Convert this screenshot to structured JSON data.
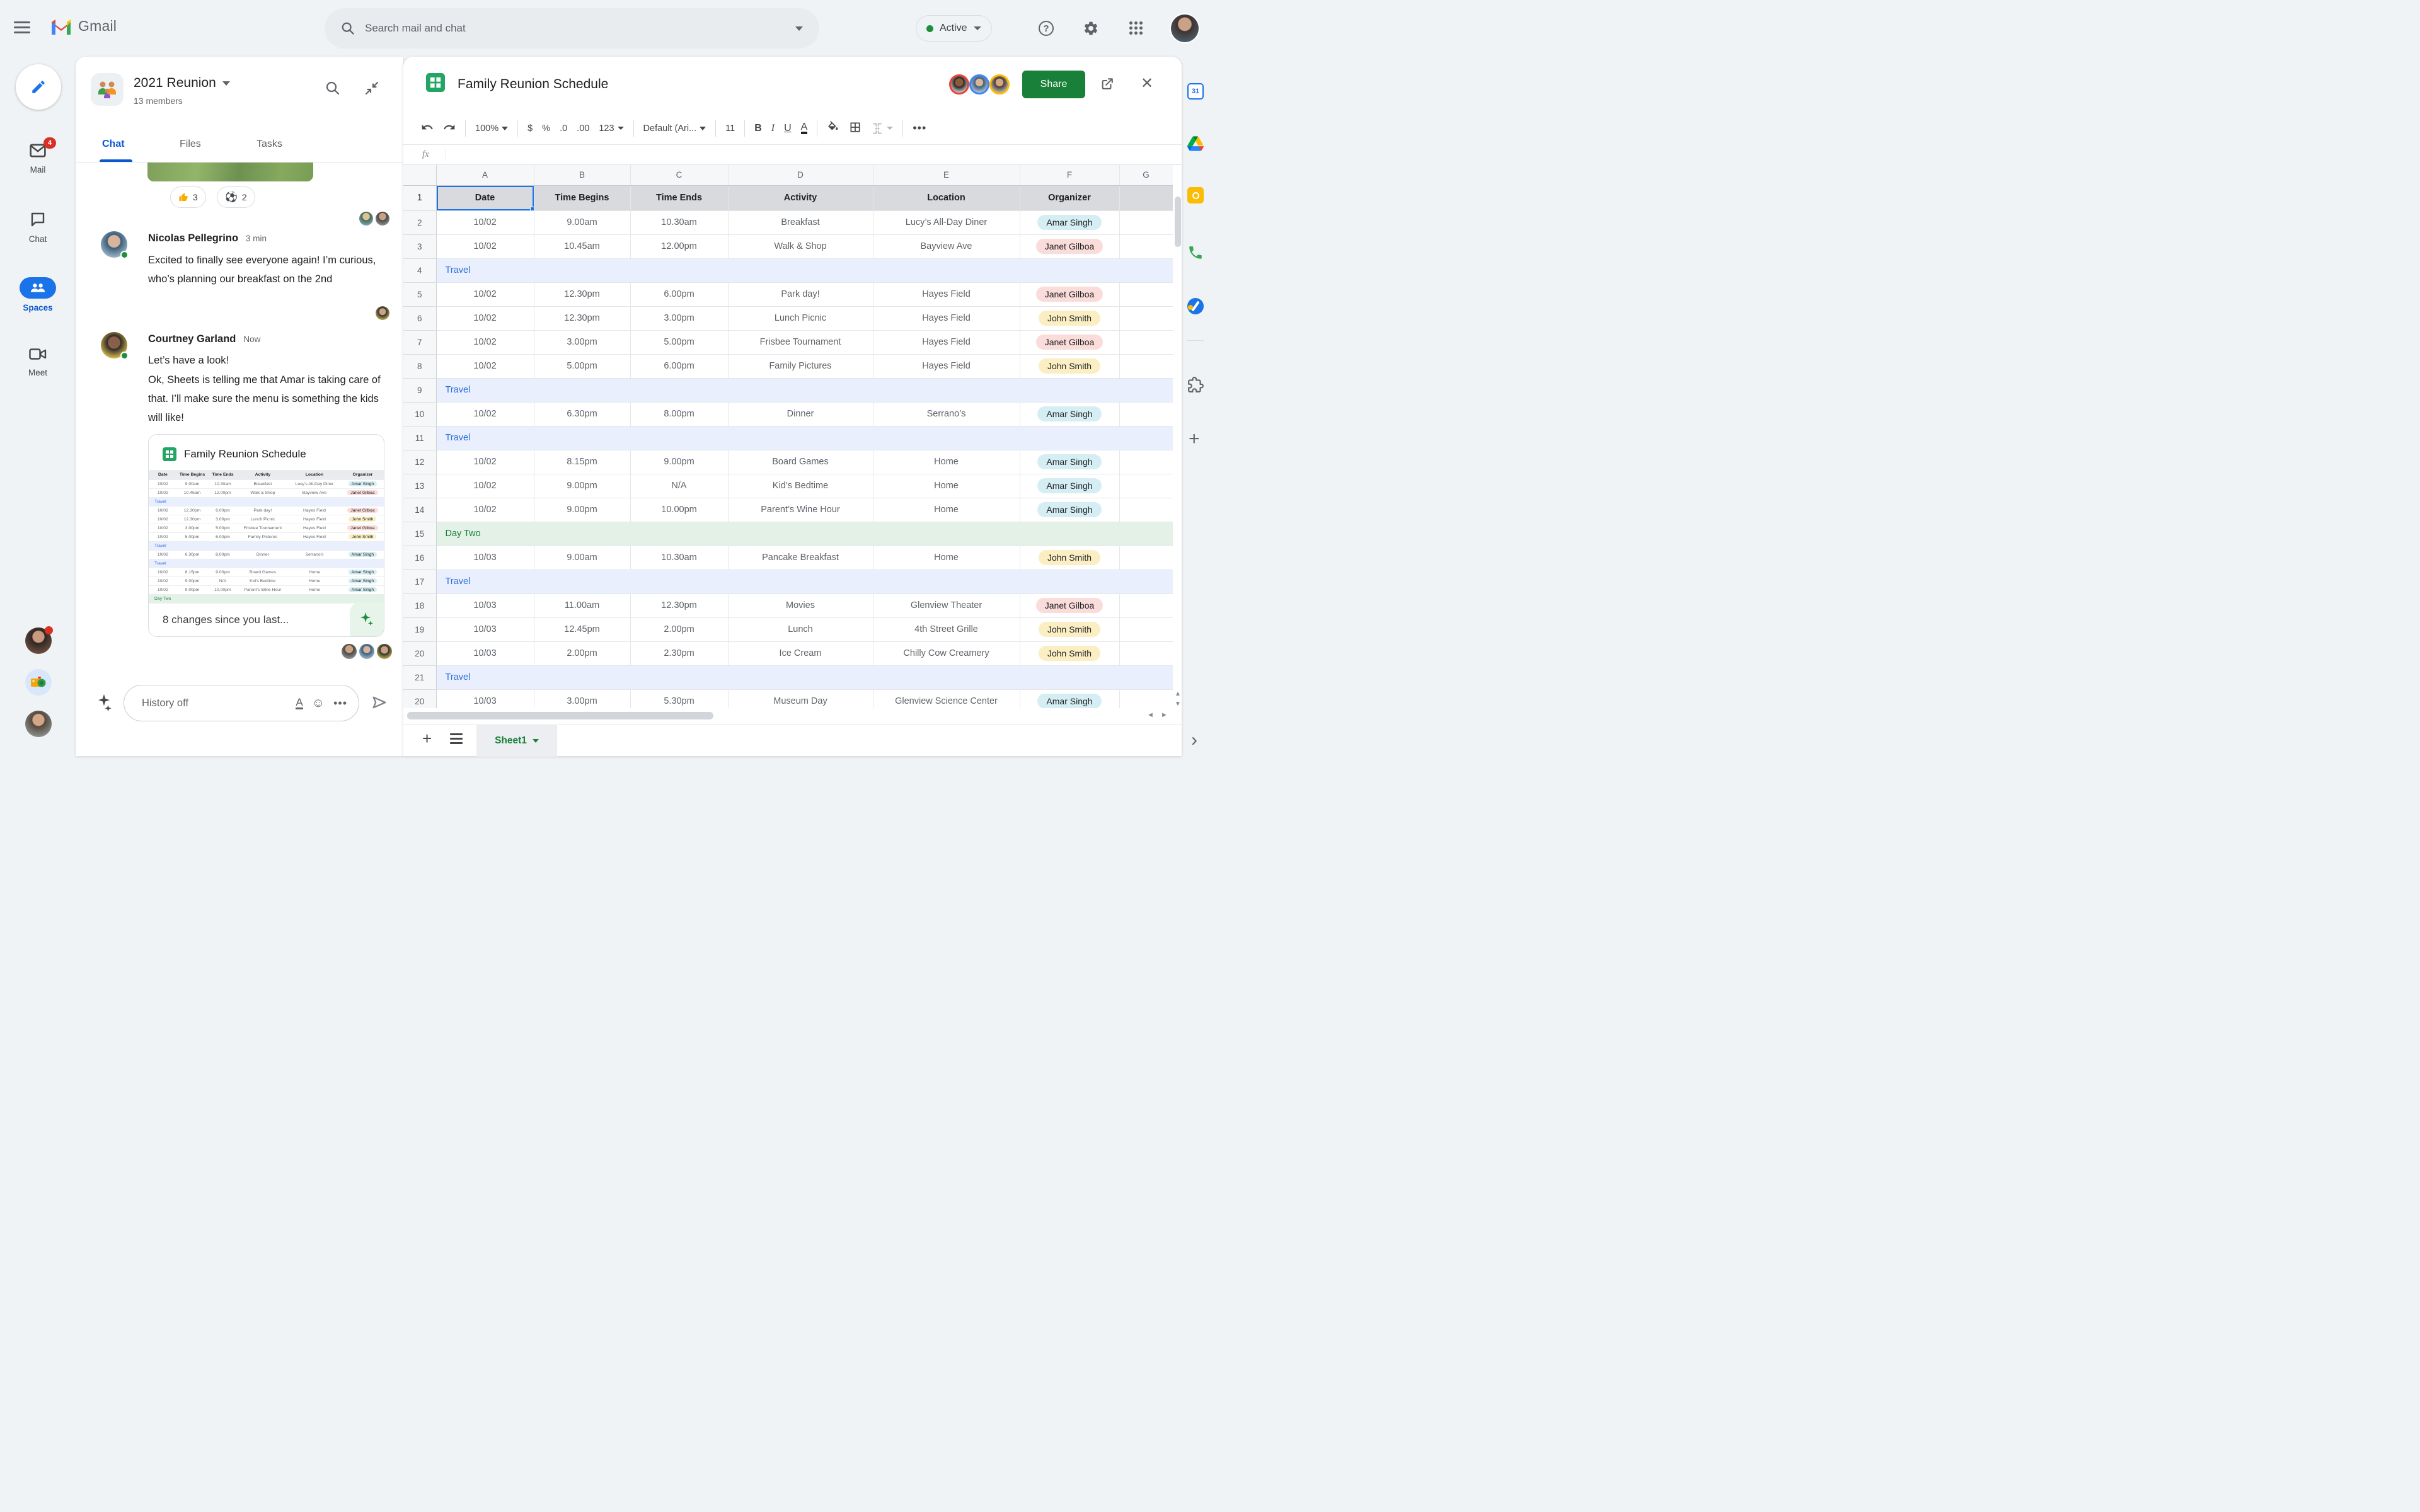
{
  "topbar": {
    "logo_text": "Gmail",
    "search": {
      "placeholder": "Search mail and chat"
    },
    "status": {
      "label": "Active"
    }
  },
  "rail": {
    "items": [
      {
        "label": "Mail",
        "badge": "4"
      },
      {
        "label": "Chat"
      },
      {
        "label": "Spaces"
      },
      {
        "label": "Meet"
      }
    ]
  },
  "chat": {
    "title": "2021 Reunion",
    "members": "13 members",
    "tabs": [
      "Chat",
      "Files",
      "Tasks"
    ],
    "reactions": [
      {
        "icon": "thumbs-up",
        "count": "3"
      },
      {
        "icon": "soccer-ball",
        "count": "2"
      }
    ],
    "messages": [
      {
        "author": "Nicolas Pellegrino",
        "time": "3 min",
        "text": "Excited to finally see everyone again! I’m curious, who’s planning our breakfast on the 2nd"
      },
      {
        "author": "Courtney Garland",
        "time": "Now",
        "text": "Let’s have a look!",
        "text2": "Ok, Sheets is telling me that Amar is taking care of that. I’ll make sure the menu is something the kids will like!"
      }
    ],
    "card": {
      "title": "Family Reunion Schedule",
      "footer": "8 changes since you last..."
    },
    "input": {
      "placeholder": "History off"
    }
  },
  "sheet": {
    "title": "Family Reunion Schedule",
    "share_label": "Share",
    "toolbar": {
      "zoom": "100%",
      "currency": "$",
      "percent": "%",
      "dec0": ".0",
      "dec00": ".00",
      "num_fmt": "123",
      "font": "Default (Ari...",
      "font_size": "11",
      "bold": "B",
      "italic": "I",
      "underline": "U",
      "text_color": "A"
    },
    "formula_bar": {
      "fx": "fx"
    },
    "columns": [
      "A",
      "B",
      "C",
      "D",
      "E",
      "F",
      "G"
    ],
    "header_row": [
      "Date",
      "Time Begins",
      "Time Ends",
      "Activity",
      "Location",
      "Organizer"
    ],
    "chip_colors": {
      "Amar Singh": "#d5eef3",
      "Janet Gilboa": "#fadcda",
      "John Smith": "#faeec2"
    },
    "band_styles": {
      "Travel": {
        "bg": "#e9effc",
        "color": "#2f6fe0"
      },
      "Day Two": {
        "bg": "#e4f1e7",
        "color": "#188038"
      }
    },
    "rows": [
      {
        "n": "2",
        "cells": [
          "10/02",
          "9.00am",
          "10.30am",
          "Breakfast",
          "Lucy’s All-Day Diner"
        ],
        "organizer": "Amar Singh"
      },
      {
        "n": "3",
        "cells": [
          "10/02",
          "10.45am",
          "12.00pm",
          "Walk & Shop",
          "Bayview Ave"
        ],
        "organizer": "Janet Gilboa"
      },
      {
        "n": "4",
        "band": "Travel"
      },
      {
        "n": "5",
        "cells": [
          "10/02",
          "12.30pm",
          "6.00pm",
          "Park day!",
          "Hayes Field"
        ],
        "organizer": "Janet Gilboa"
      },
      {
        "n": "6",
        "cells": [
          "10/02",
          "12.30pm",
          "3.00pm",
          "Lunch Picnic",
          "Hayes Field"
        ],
        "organizer": "John Smith"
      },
      {
        "n": "7",
        "cells": [
          "10/02",
          "3.00pm",
          "5.00pm",
          "Frisbee Tournament",
          "Hayes Field"
        ],
        "organizer": "Janet Gilboa"
      },
      {
        "n": "8",
        "cells": [
          "10/02",
          "5.00pm",
          "6.00pm",
          "Family Pictures",
          "Hayes Field"
        ],
        "organizer": "John Smith"
      },
      {
        "n": "9",
        "band": "Travel"
      },
      {
        "n": "10",
        "cells": [
          "10/02",
          "6.30pm",
          "8.00pm",
          "Dinner",
          "Serrano’s"
        ],
        "organizer": "Amar Singh"
      },
      {
        "n": "11",
        "band": "Travel"
      },
      {
        "n": "12",
        "cells": [
          "10/02",
          "8.15pm",
          "9.00pm",
          "Board Games",
          "Home"
        ],
        "organizer": "Amar Singh"
      },
      {
        "n": "13",
        "cells": [
          "10/02",
          "9.00pm",
          "N/A",
          "Kid’s Bedtime",
          "Home"
        ],
        "organizer": "Amar Singh"
      },
      {
        "n": "14",
        "cells": [
          "10/02",
          "9.00pm",
          "10.00pm",
          "Parent’s Wine Hour",
          "Home"
        ],
        "organizer": "Amar Singh"
      },
      {
        "n": "15",
        "band": "Day Two"
      },
      {
        "n": "16",
        "cells": [
          "10/03",
          "9.00am",
          "10.30am",
          "Pancake Breakfast",
          "Home"
        ],
        "organizer": "John Smith"
      },
      {
        "n": "17",
        "band": "Travel"
      },
      {
        "n": "18",
        "cells": [
          "10/03",
          "11.00am",
          "12.30pm",
          "Movies",
          "Glenview Theater"
        ],
        "organizer": "Janet Gilboa"
      },
      {
        "n": "19",
        "cells": [
          "10/03",
          "12.45pm",
          "2.00pm",
          "Lunch",
          "4th Street Grille"
        ],
        "organizer": "John Smith"
      },
      {
        "n": "20",
        "cells": [
          "10/03",
          "2.00pm",
          "2.30pm",
          "Ice Cream",
          "Chilly Cow Creamery"
        ],
        "organizer": "John Smith"
      },
      {
        "n": "21",
        "band": "Travel"
      },
      {
        "n": "20",
        "cells": [
          "10/03",
          "3.00pm",
          "5.30pm",
          "Museum Day",
          "Glenview Science Center"
        ],
        "organizer": "Amar Singh"
      }
    ],
    "card_rows_count": 14,
    "collaborator_ring_colors": [
      "#ea4335",
      "#4285f4",
      "#fbbc04"
    ],
    "footer": {
      "sheet_tab": "Sheet1"
    }
  }
}
